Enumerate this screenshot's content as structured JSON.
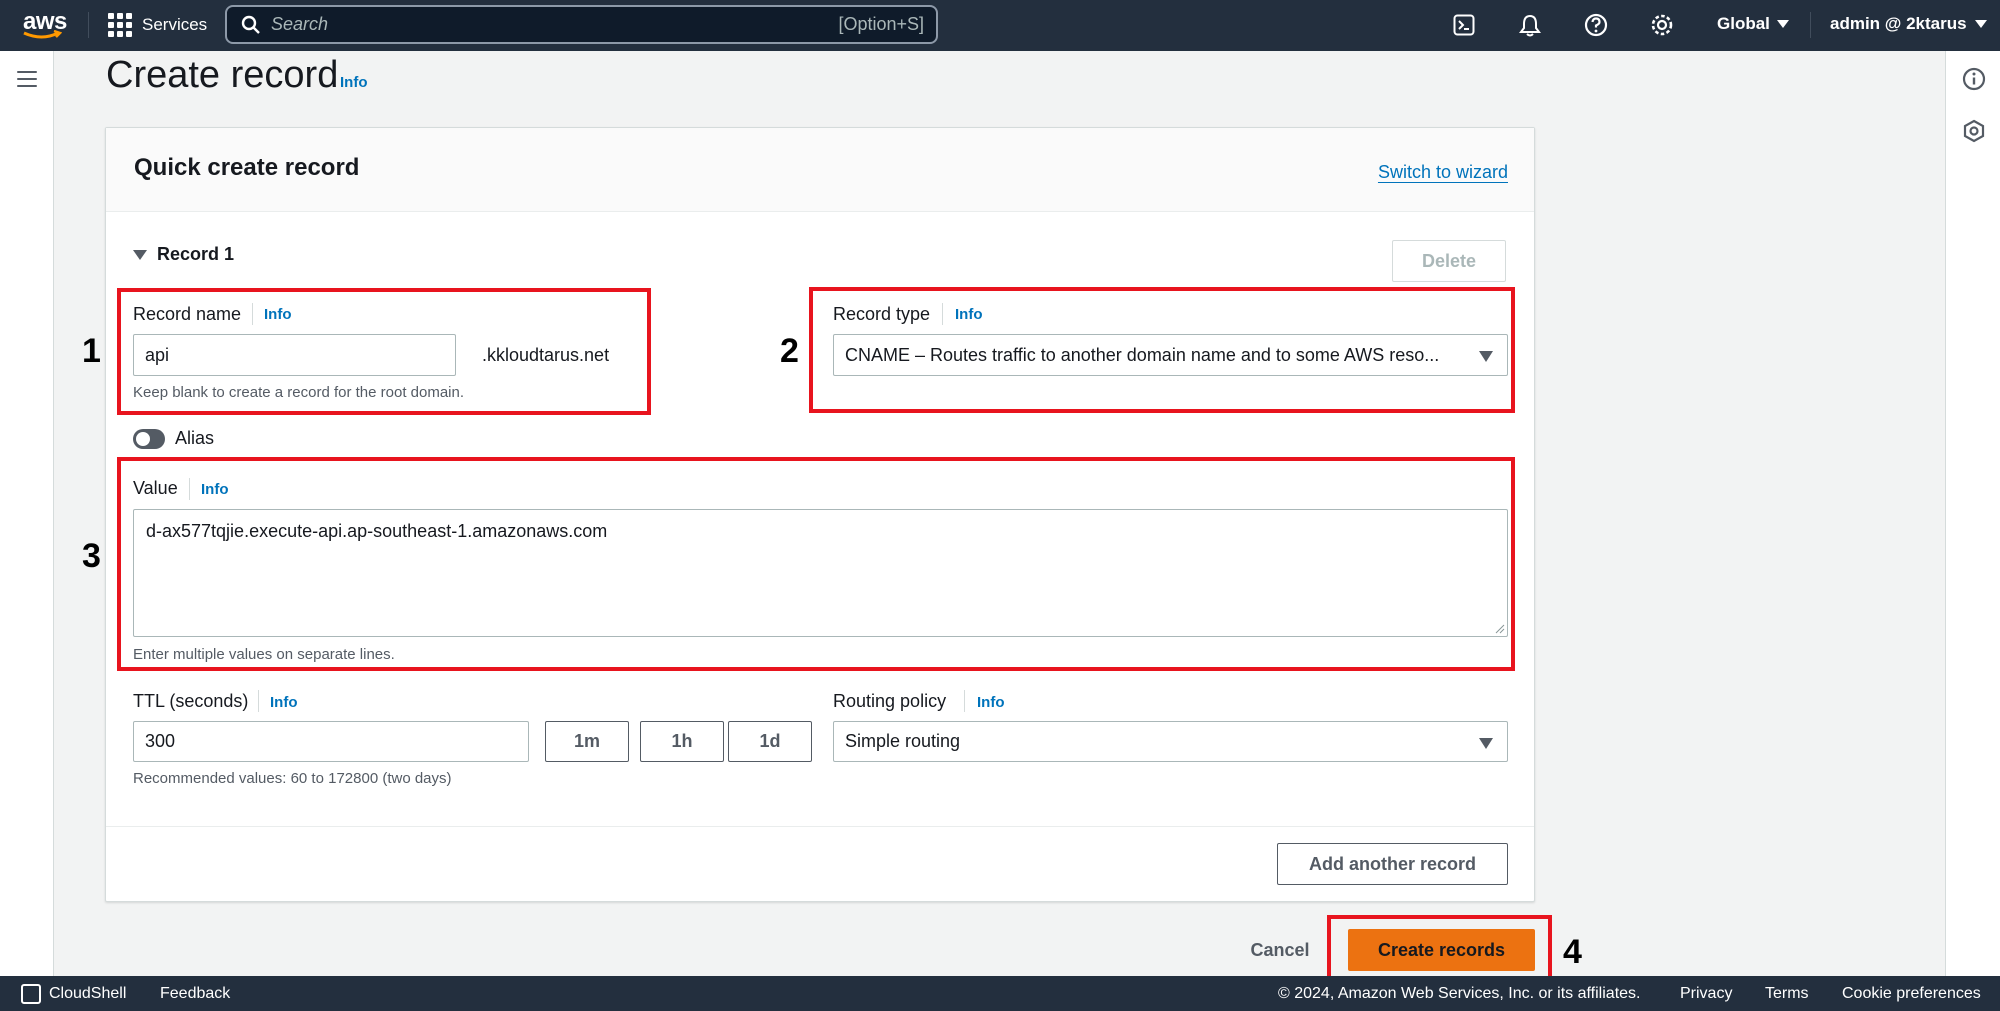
{
  "topnav": {
    "logo_text": "aws",
    "services_label": "Services",
    "search_placeholder": "Search",
    "search_shortcut": "[Option+S]",
    "region_label": "Global",
    "account_label": "admin @ 2ktarus"
  },
  "page": {
    "title": "Create record",
    "info_label": "Info"
  },
  "card": {
    "title": "Quick create record",
    "switch_link": "Switch to wizard",
    "record_toggle_label": "Record 1",
    "delete_label": "Delete"
  },
  "record_name": {
    "label": "Record name",
    "info": "Info",
    "value": "api",
    "suffix": ".kkloudtarus.net",
    "hint": "Keep blank to create a record for the root domain."
  },
  "record_type": {
    "label": "Record type",
    "info": "Info",
    "value": "CNAME – Routes traffic to another domain name and to some AWS reso..."
  },
  "alias": {
    "label": "Alias"
  },
  "value_field": {
    "label": "Value",
    "info": "Info",
    "value": "d-ax577tqjie.execute-api.ap-southeast-1.amazonaws.com",
    "hint": "Enter multiple values on separate lines."
  },
  "ttl": {
    "label": "TTL (seconds)",
    "info": "Info",
    "value": "300",
    "hint": "Recommended values: 60 to 172800 (two days)",
    "units": [
      "1m",
      "1h",
      "1d"
    ]
  },
  "routing": {
    "label": "Routing policy",
    "info": "Info",
    "value": "Simple routing"
  },
  "actions": {
    "add_record": "Add another record",
    "cancel": "Cancel",
    "create": "Create records"
  },
  "annotations": [
    "1",
    "2",
    "3",
    "4"
  ],
  "footer": {
    "cloudshell": "CloudShell",
    "feedback": "Feedback",
    "copyright": "© 2024, Amazon Web Services, Inc. or its affiliates.",
    "privacy": "Privacy",
    "terms": "Terms",
    "cookies": "Cookie preferences"
  },
  "colors": {
    "nav_bg": "#232f3e",
    "link": "#0073bb",
    "primary_button": "#ec7211",
    "annotation": "#e8141e"
  }
}
